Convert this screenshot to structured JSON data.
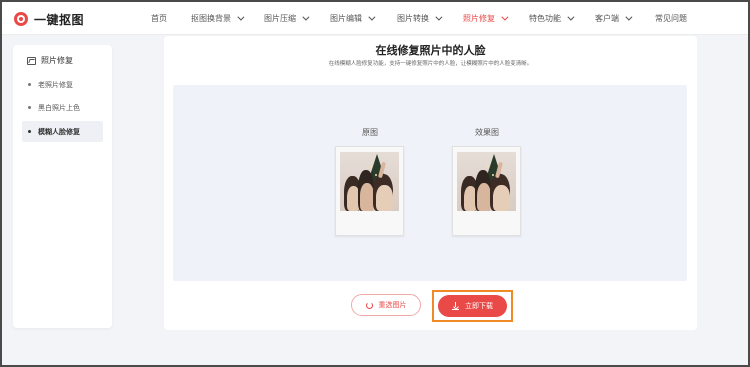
{
  "brand": {
    "name": "一键抠图",
    "accent": "#e94a47",
    "highlight": "#f08a26"
  },
  "nav": {
    "items": [
      {
        "label": "首页",
        "has_dropdown": false,
        "active": false
      },
      {
        "label": "抠图换背景",
        "has_dropdown": true,
        "active": false
      },
      {
        "label": "图片压缩",
        "has_dropdown": true,
        "active": false
      },
      {
        "label": "图片编辑",
        "has_dropdown": true,
        "active": false
      },
      {
        "label": "图片转换",
        "has_dropdown": true,
        "active": false
      },
      {
        "label": "照片修复",
        "has_dropdown": true,
        "active": true
      },
      {
        "label": "特色功能",
        "has_dropdown": true,
        "active": false
      },
      {
        "label": "客户端",
        "has_dropdown": true,
        "active": false
      },
      {
        "label": "常见问题",
        "has_dropdown": false,
        "active": false
      }
    ]
  },
  "sidebar": {
    "title": "照片修复",
    "title_icon": "image-icon",
    "items": [
      {
        "label": "老照片修复",
        "active": false
      },
      {
        "label": "黑白照片上色",
        "active": false
      },
      {
        "label": "模糊人脸修复",
        "active": true
      }
    ]
  },
  "main": {
    "title": "在线修复照片中的人脸",
    "subtitle": "在线模糊人脸修复功能，支持一键修复照片中的人脸，让模糊照片中的人脸变清晰。",
    "original_label": "原图",
    "result_label": "效果图",
    "reselect_label": "重选图片",
    "download_label": "立即下载"
  }
}
